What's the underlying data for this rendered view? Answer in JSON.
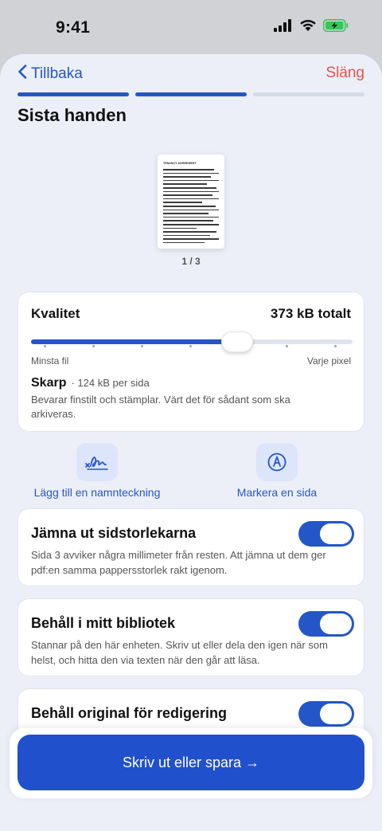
{
  "status_bar": {
    "time": "9:41",
    "icons": [
      "signal-icon",
      "wifi-icon",
      "battery-charging-icon"
    ]
  },
  "nav": {
    "back_label": "Tillbaka",
    "discard_label": "Släng"
  },
  "progress": {
    "total_steps": 3,
    "completed_steps": 2
  },
  "page_title": "Sista handen",
  "preview": {
    "document_heading": "TENANCY AGREEMENT",
    "page_counter": "1 / 3"
  },
  "quality": {
    "label": "Kvalitet",
    "total": "373 kB totalt",
    "slider_value": 0.64,
    "min_label": "Minsta fil",
    "max_label": "Varje pixel",
    "preset_name": "Skarp",
    "preset_size": "· 124 kB per sida",
    "preset_description": "Bevarar finstilt och stämplar. Värt det för sådant som ska arkiveras."
  },
  "actions": [
    {
      "label": "Lägg till en namnteckning",
      "icon": "signature-icon"
    },
    {
      "label": "Markera en sida",
      "icon": "markup-pen-icon"
    }
  ],
  "toggles": [
    {
      "title": "Jämna ut sidstorlekarna",
      "description": "Sida 3 avviker några millimeter från resten. Att jämna ut dem ger pdf:en samma pappersstorlek rakt igenom.",
      "on": true
    },
    {
      "title": "Behåll i mitt bibliotek",
      "description": "Stannar på den här enheten. Skriv ut eller dela den igen när som helst, och hitta den via texten när den går att läsa.",
      "on": true
    },
    {
      "title": "Behåll original för redigering",
      "description": "",
      "on": true
    }
  ],
  "primary_action": {
    "label": "Skriv ut eller spara →"
  },
  "colors": {
    "accent": "#2556c8",
    "destructive": "#e5534b",
    "sheet_background": "#eceff8"
  }
}
